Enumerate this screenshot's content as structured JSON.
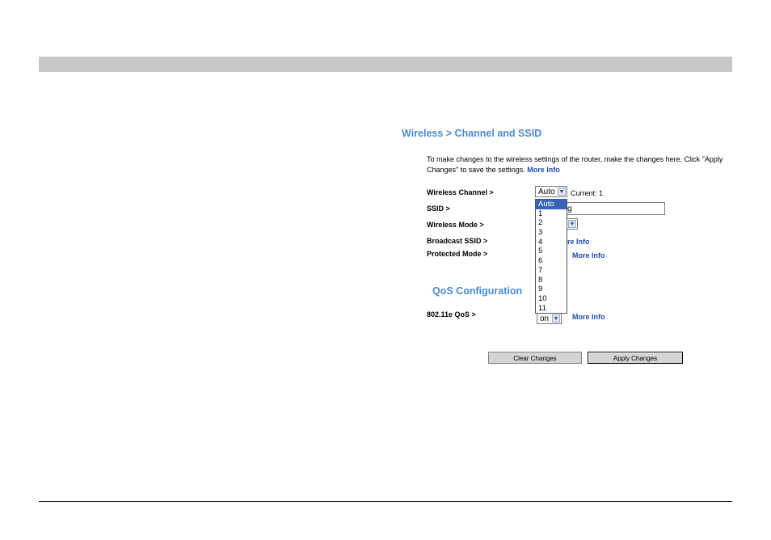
{
  "page": {
    "title": "Wireless > Channel and SSID",
    "description": "To make changes to the wireless settings of the router, make the changes here. Click \"Apply Changes\" to save the settings.",
    "description_link": "More Info"
  },
  "wireless_channel": {
    "label": "Wireless Channel >",
    "selected": "Auto",
    "current_text": "Current: 1",
    "options": [
      "Auto",
      "1",
      "2",
      "3",
      "4",
      "5",
      "6",
      "7",
      "8",
      "9",
      "10",
      "11"
    ]
  },
  "ssid": {
    "label": "SSID >",
    "value": "g"
  },
  "wireless_mode": {
    "label": "Wireless Mode >"
  },
  "broadcast_ssid": {
    "label": "Broadcast SSID >",
    "link_fragment": "re Info"
  },
  "protected_mode": {
    "label": "Protected Mode >",
    "link": "More Info"
  },
  "qos": {
    "title": "QoS Configuration",
    "label": "802.11e QoS >",
    "selected": "on",
    "link": "More Info"
  },
  "buttons": {
    "clear": "Clear Changes",
    "apply": "Apply Changes"
  },
  "icons": {
    "dropdown_arrow": "chevron-down-icon"
  },
  "colors": {
    "heading": "#4a8bd0",
    "link": "#1f4fa8",
    "selected_option": "#3a64b8"
  }
}
